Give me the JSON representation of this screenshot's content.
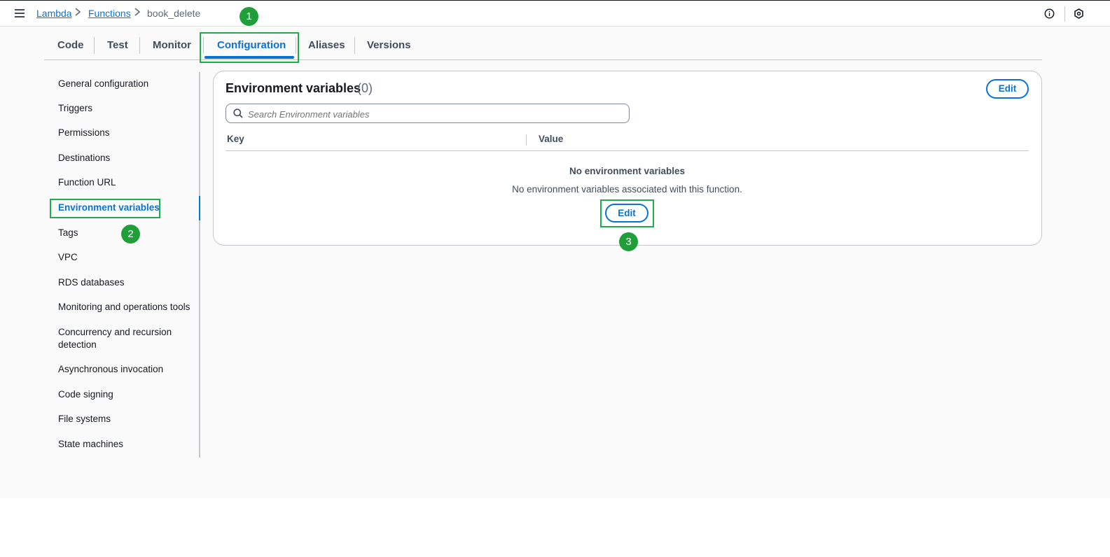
{
  "breadcrumb": {
    "items": [
      "Lambda",
      "Functions"
    ],
    "current": "book_delete"
  },
  "tabs": [
    "Code",
    "Test",
    "Monitor",
    "Configuration",
    "Aliases",
    "Versions"
  ],
  "active_tab": "Configuration",
  "sidebar": {
    "items": [
      "General configuration",
      "Triggers",
      "Permissions",
      "Destinations",
      "Function URL",
      "Environment variables",
      "Tags",
      "VPC",
      "RDS databases",
      "Monitoring and operations tools",
      "Concurrency and recursion",
      "detection",
      "Asynchronous invocation",
      "Code signing",
      "File systems",
      "State machines"
    ],
    "active": "Environment variables"
  },
  "panel": {
    "title": "Environment variables",
    "count": "(0)",
    "edit_label": "Edit",
    "search_placeholder": "Search Environment variables",
    "columns": [
      "Key",
      "Value"
    ],
    "empty_title": "No environment variables",
    "empty_desc": "No environment variables associated with this function.",
    "empty_edit_label": "Edit"
  },
  "annotations": [
    "1",
    "2",
    "3"
  ],
  "colors": {
    "accent": "#0972d3",
    "highlight": "#1fad4d",
    "badge": "#1f9e3a"
  }
}
